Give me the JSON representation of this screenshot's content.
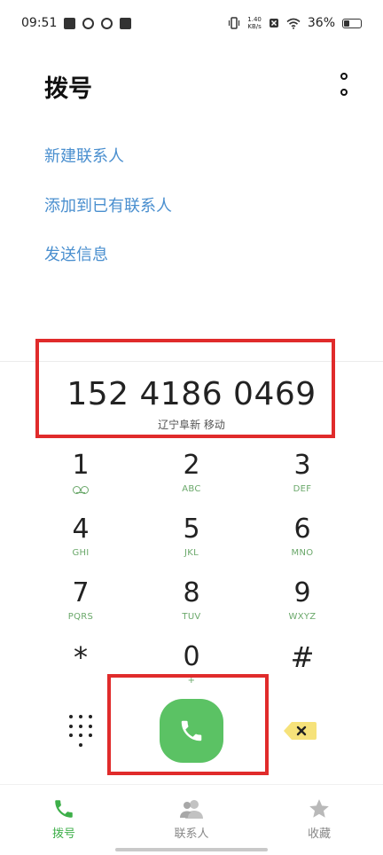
{
  "status_bar": {
    "time": "09:51",
    "net_speed_value": "1.40",
    "net_speed_unit": "KB/s",
    "battery_percent": "36%"
  },
  "header": {
    "title": "拨号"
  },
  "actions": {
    "new_contact": "新建联系人",
    "add_to_existing": "添加到已有联系人",
    "send_message": "发送信息"
  },
  "dialed": {
    "number": "152 4186 0469",
    "location": "辽宁阜新 移动"
  },
  "keypad": [
    {
      "digit": "1",
      "letters": ""
    },
    {
      "digit": "2",
      "letters": "ABC"
    },
    {
      "digit": "3",
      "letters": "DEF"
    },
    {
      "digit": "4",
      "letters": "GHI"
    },
    {
      "digit": "5",
      "letters": "JKL"
    },
    {
      "digit": "6",
      "letters": "MNO"
    },
    {
      "digit": "7",
      "letters": "PQRS"
    },
    {
      "digit": "8",
      "letters": "TUV"
    },
    {
      "digit": "9",
      "letters": "WXYZ"
    },
    {
      "digit": "*",
      "letters": ""
    },
    {
      "digit": "0",
      "letters": "+"
    },
    {
      "digit": "#",
      "letters": ""
    }
  ],
  "nav": {
    "dial": "拨号",
    "contacts": "联系人",
    "favorites": "收藏"
  },
  "colors": {
    "accent_green": "#5bc264",
    "link_blue": "#4a8fcf",
    "highlight_red": "#e02b2b",
    "backspace_yellow": "#f6e27a"
  }
}
